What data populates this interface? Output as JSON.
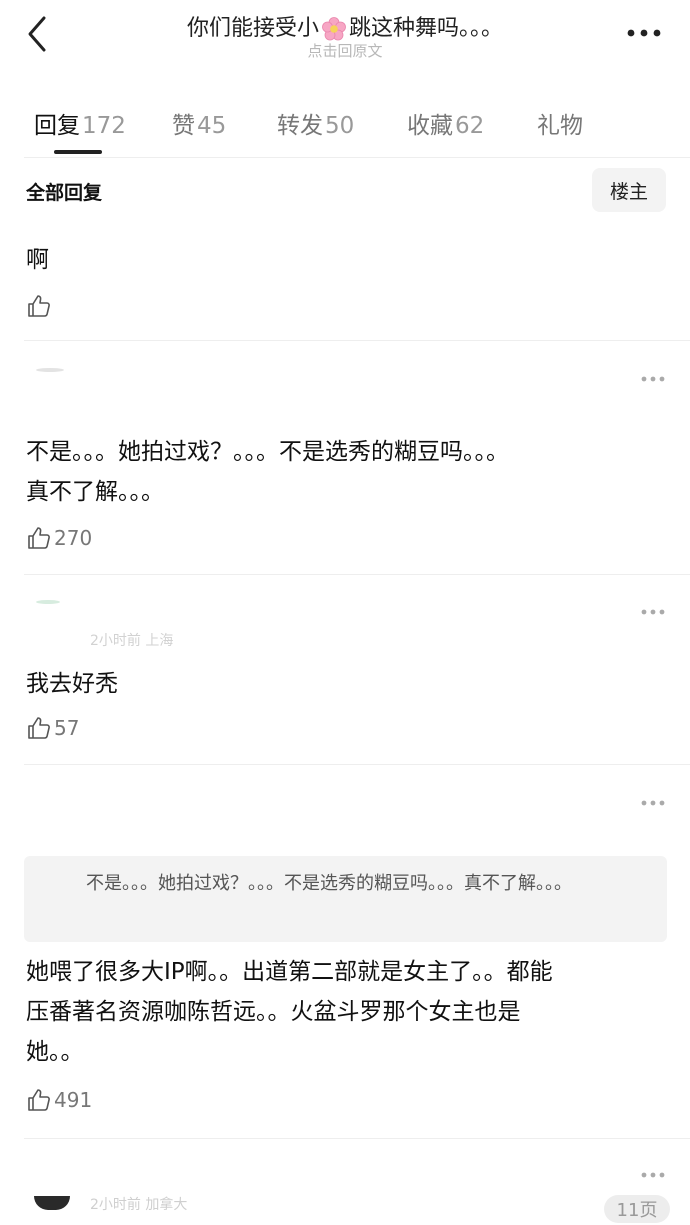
{
  "header": {
    "title_before": "你们能接受小",
    "title_after": "跳这种舞吗。。。",
    "subtitle": "点击回原文"
  },
  "tabs": [
    {
      "label": "回复",
      "count": "172",
      "active": true
    },
    {
      "label": "赞",
      "count": "45"
    },
    {
      "label": "转发",
      "count": "50"
    },
    {
      "label": "收藏",
      "count": "62"
    },
    {
      "label": "礼物",
      "count": ""
    }
  ],
  "section": {
    "title": "全部回复",
    "owner_filter": "楼主"
  },
  "comments": [
    {
      "text": "啊",
      "likes": ""
    },
    {
      "text_lines": [
        "不是。。。她拍过戏？。。。不是选秀的糊豆吗。。。",
        "真不了解。。。"
      ],
      "likes": "270"
    },
    {
      "meta": "2小时前 上海",
      "text": "我去好秃",
      "likes": "57"
    },
    {
      "quote": "不是。。。她拍过戏？。。。不是选秀的糊豆吗。。。真不了解。。。",
      "text_lines": [
        "她喂了很多大IP啊。。出道第二部就是女主了。。都能",
        "压番著名资源咖陈哲远。。火盆斗罗那个女主也是",
        "她。。"
      ],
      "likes": "491"
    },
    {
      "meta": "2小时前 加拿大"
    }
  ],
  "watermark": "11页",
  "colors": {
    "text": "#111111",
    "muted": "#777777",
    "divider": "#eeeeee",
    "chip_bg": "#f3f3f3"
  }
}
